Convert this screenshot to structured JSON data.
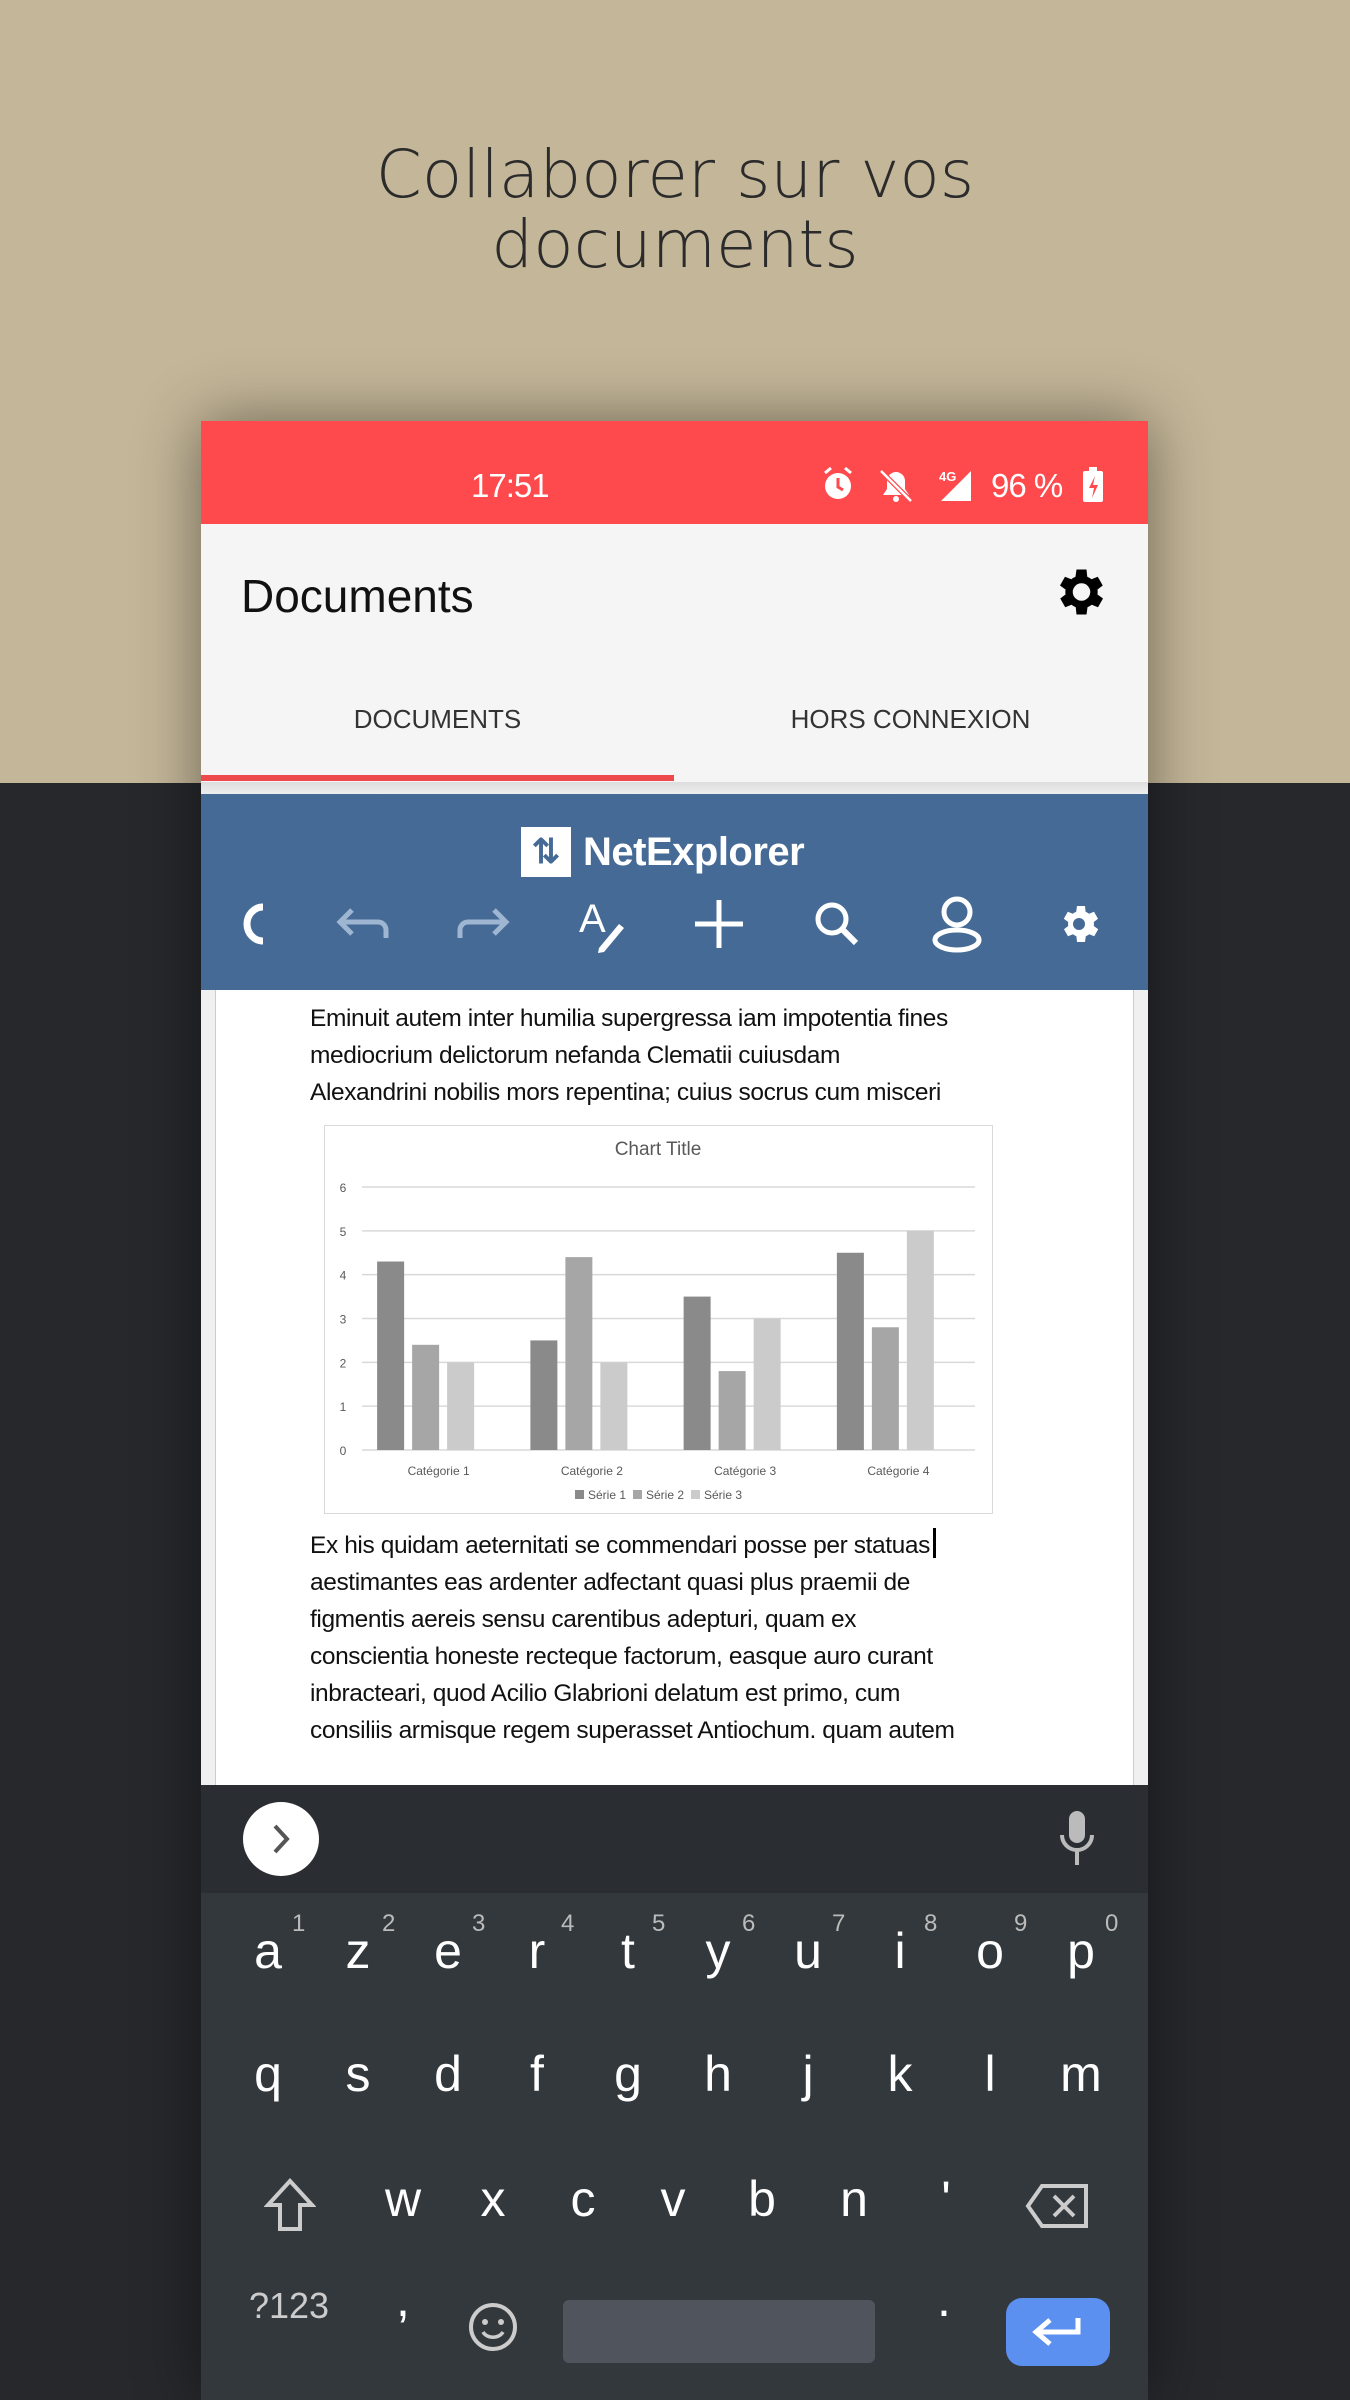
{
  "headline": [
    "Collaborer sur vos",
    "documents"
  ],
  "status": {
    "time": "17:51",
    "battery": "96 %",
    "network": "4G"
  },
  "app": {
    "title": "Documents",
    "tabs": [
      {
        "label": "DOCUMENTS",
        "active": true
      },
      {
        "label": "HORS CONNEXION",
        "active": false
      }
    ],
    "accent": "#ff4a4d"
  },
  "toolbar": {
    "brand": "NetExplorer",
    "color": "#466a96",
    "icons": [
      "close-partial-icon",
      "undo-icon",
      "redo-icon",
      "text-format-icon",
      "add-icon",
      "search-icon",
      "user-icon",
      "settings-icon"
    ]
  },
  "document": {
    "para1": [
      "Eminuit autem inter humilia supergressa iam impotentia fines",
      "mediocrium delictorum nefanda Clematii cuiusdam",
      "Alexandrini nobilis mors repentina; cuius socrus cum misceri"
    ],
    "para2": [
      "Ex his quidam aeternitati se commendari posse per statuas",
      "aestimantes eas ardenter adfectant quasi plus praemii de",
      "figmentis aereis sensu carentibus adepturi, quam ex",
      "conscientia honeste recteque factorum, easque auro curant",
      "inbracteari, quod Acilio Glabrioni delatum est primo, cum",
      "consiliis armisque regem superasset Antiochum. quam autem"
    ]
  },
  "chart_data": {
    "type": "bar",
    "title": "Chart Title",
    "categories": [
      "Catégorie 1",
      "Catégorie 2",
      "Catégorie 3",
      "Catégorie 4"
    ],
    "series": [
      {
        "name": "Série 1",
        "values": [
          4.3,
          2.5,
          3.5,
          4.5
        ],
        "color": "#8a8a8a"
      },
      {
        "name": "Série 2",
        "values": [
          2.4,
          4.4,
          1.8,
          2.8
        ],
        "color": "#a6a6a6"
      },
      {
        "name": "Série 3",
        "values": [
          2,
          2,
          3,
          5
        ],
        "color": "#cbcbcb"
      }
    ],
    "ylim": [
      0,
      6
    ],
    "yticks": [
      "0",
      "1",
      "2",
      "3",
      "4",
      "5",
      "6"
    ],
    "grid": true,
    "legend": "bottom"
  },
  "keyboard": {
    "row1": [
      "a",
      "z",
      "e",
      "r",
      "t",
      "y",
      "u",
      "i",
      "o",
      "p"
    ],
    "row1_nums": [
      "1",
      "2",
      "3",
      "4",
      "5",
      "6",
      "7",
      "8",
      "9",
      "0"
    ],
    "row2": [
      "q",
      "s",
      "d",
      "f",
      "g",
      "h",
      "j",
      "k",
      "l",
      "m"
    ],
    "row3": [
      "w",
      "x",
      "c",
      "v",
      "b",
      "n",
      "'"
    ],
    "symbols": "?123",
    "comma": ",",
    "period": ".",
    "enter_color": "#5b8ff0"
  }
}
